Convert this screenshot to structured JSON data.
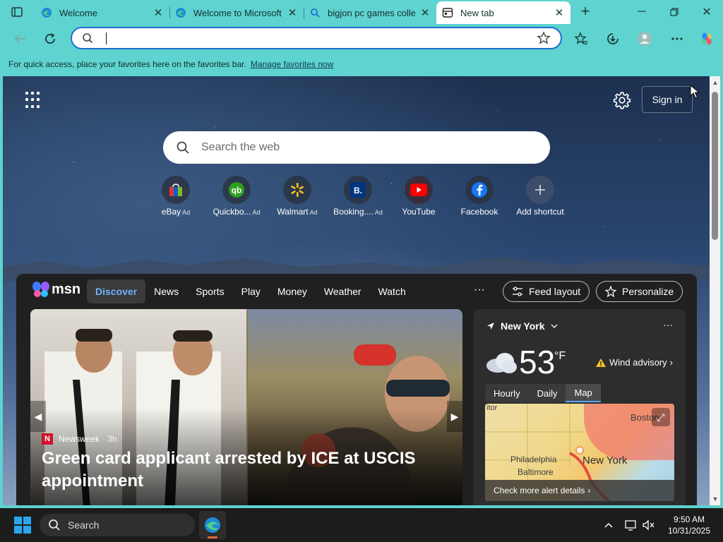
{
  "tabs": [
    {
      "title": "Welcome",
      "icon": "edge-icon"
    },
    {
      "title": "Welcome to Microsoft E",
      "icon": "edge-icon"
    },
    {
      "title": "bigjon pc games collect",
      "icon": "search-icon"
    },
    {
      "title": "New tab",
      "icon": "new-tab-page-icon",
      "active": true
    }
  ],
  "omnibox": {
    "value": "",
    "placeholder": ""
  },
  "favbar": {
    "text": "For quick access, place your favorites here on the favorites bar.",
    "link": "Manage favorites now"
  },
  "ntp": {
    "sign_in": "Sign in",
    "search_placeholder": "Search the web",
    "shortcuts": [
      {
        "label": "eBay",
        "ad": "Ad",
        "color": "#e53238"
      },
      {
        "label": "Quickbo...",
        "ad": "Ad",
        "color": "#2ca01c"
      },
      {
        "label": "Walmart",
        "ad": "Ad",
        "color": "#0071dc"
      },
      {
        "label": "Booking....",
        "ad": "Ad",
        "color": "#003580"
      },
      {
        "label": "YouTube",
        "ad": "",
        "color": "#ff0000"
      },
      {
        "label": "Facebook",
        "ad": "",
        "color": "#1877f2"
      },
      {
        "label": "Add shortcut",
        "ad": "",
        "color": "#ffffff"
      }
    ]
  },
  "msn": {
    "logo": "msn",
    "nav": [
      "Discover",
      "News",
      "Sports",
      "Play",
      "Money",
      "Weather",
      "Watch"
    ],
    "more": "···",
    "feed_layout": "Feed layout",
    "personalize": "Personalize",
    "hero": {
      "source": "Newsweek",
      "age": "· 3h",
      "headline": "Green card applicant arrested by ICE at USCIS appointment"
    },
    "weather": {
      "location": "New York",
      "temp": "53",
      "unit": "°F",
      "advisory": "Wind advisory",
      "tabs": [
        "Hourly",
        "Daily",
        "Map"
      ],
      "map_labels": {
        "city1": "Boston",
        "city2": "Philadelphia",
        "city3": "Baltimore",
        "city4": "New York",
        "edge": "itor"
      },
      "alerts": "Check more alert details"
    }
  },
  "taskbar": {
    "search": "Search",
    "time": "9:50 AM",
    "date": "10/31/2025"
  },
  "colors": {
    "chrome": "#5fd3cf",
    "accent": "#1f6fd1",
    "feed_bg": "#202020",
    "active_nav": "#6fb0ff"
  }
}
